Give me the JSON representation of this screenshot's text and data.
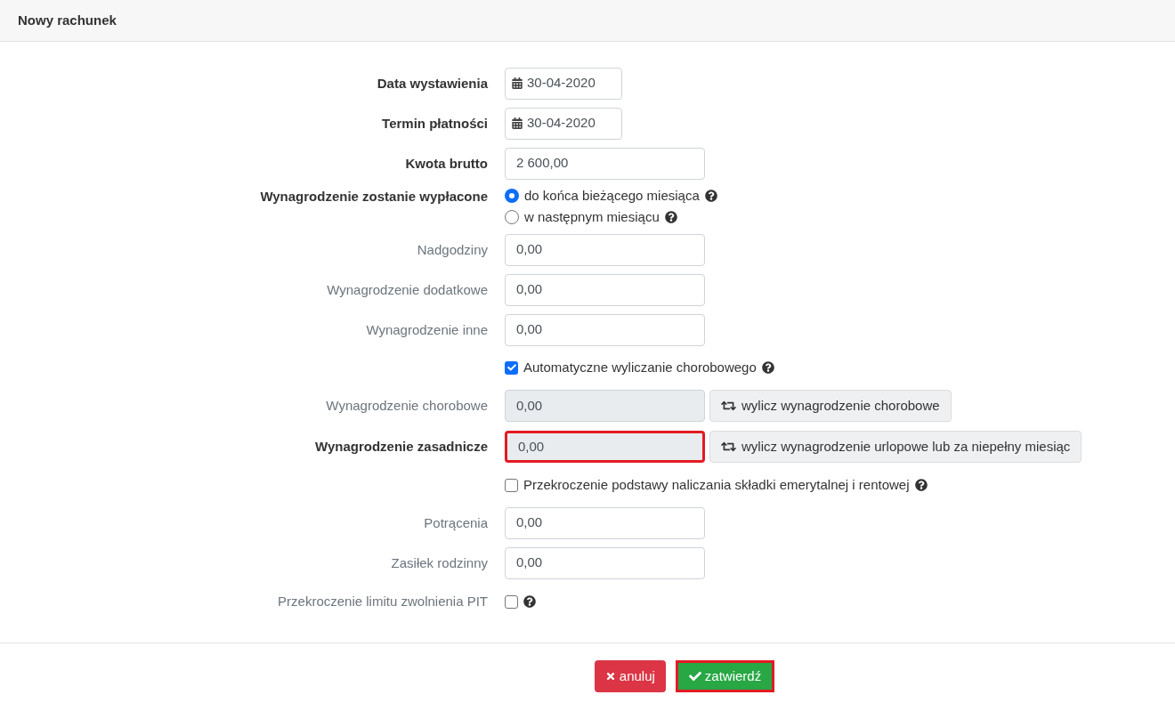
{
  "header": {
    "title": "Nowy rachunek"
  },
  "rows": [
    {
      "kind": "date",
      "label": "Data wystawienia",
      "bold": true,
      "value": "30-04-2020"
    },
    {
      "kind": "date",
      "label": "Termin płatności",
      "bold": true,
      "value": "30-04-2020"
    },
    {
      "kind": "input",
      "label": "Kwota brutto",
      "bold": true,
      "value": "2 600,00"
    },
    {
      "kind": "radio",
      "label": "Wynagrodzenie zostanie wypłacone",
      "bold": true,
      "options": [
        {
          "label": "do końca bieżącego miesiąca",
          "selected": true
        },
        {
          "label": "w następnym miesiącu",
          "selected": false
        }
      ]
    },
    {
      "kind": "input",
      "label": "Nadgodziny",
      "bold": false,
      "value": "0,00"
    },
    {
      "kind": "input",
      "label": "Wynagrodzenie dodatkowe",
      "bold": false,
      "value": "0,00"
    },
    {
      "kind": "input",
      "label": "Wynagrodzenie inne",
      "bold": false,
      "value": "0,00"
    },
    {
      "kind": "checkbox",
      "text": "Automatyczne wyliczanie chorobowego",
      "checked": true
    },
    {
      "kind": "input_button",
      "label": "Wynagrodzenie chorobowe",
      "bold": false,
      "value": "0,00",
      "readonly": true,
      "highlighted": false,
      "button": "wylicz wynagrodzenie chorobowe"
    },
    {
      "kind": "input_button",
      "label": "Wynagrodzenie zasadnicze",
      "bold": true,
      "value": "0,00",
      "readonly": true,
      "highlighted": true,
      "button": "wylicz wynagrodzenie urlopowe lub za niepełny miesiąc"
    },
    {
      "kind": "checkbox",
      "text": "Przekroczenie podstawy naliczania składki emerytalnej i rentowej",
      "checked": false
    },
    {
      "kind": "input",
      "label": "Potrącenia",
      "bold": false,
      "value": "0,00"
    },
    {
      "kind": "input",
      "label": "Zasiłek rodzinny",
      "bold": false,
      "value": "0,00"
    },
    {
      "kind": "label_checkbox",
      "label": "Przekroczenie limitu zwolnienia PIT",
      "bold": false,
      "checked": false
    }
  ],
  "footer": {
    "cancel": {
      "label": "anuluj",
      "highlighted": false
    },
    "confirm": {
      "label": "zatwierdź",
      "highlighted": true
    }
  }
}
